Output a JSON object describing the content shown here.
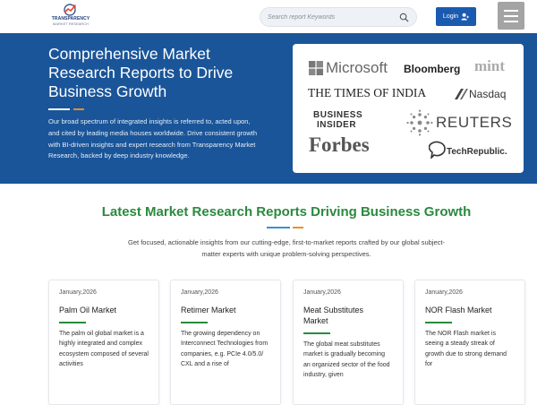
{
  "header": {
    "logo_line1": "TRANSPARENCY",
    "logo_line2": "MARKET RESEARCH",
    "search_placeholder": "Search report Keywords",
    "login_label": "Login"
  },
  "hero": {
    "title": "Comprehensive Market Research Reports to Drive Business Growth",
    "description": "Our broad spectrum of integrated insights is referred to, acted upon, and cited by leading media houses worldwide. Drive consistent growth with BI-driven insights and expert research from Transparency Market Research, backed by deep industry knowledge.",
    "logos": {
      "microsoft": "Microsoft",
      "bloomberg": "Bloomberg",
      "mint": "mint",
      "toi": "THE TIMES OF INDIA",
      "nasdaq": "Nasdaq",
      "bi_line1": "BUSINESS",
      "bi_line2": "INSIDER",
      "reuters": "REUTERS",
      "forbes": "Forbes",
      "techrepublic": "TechRepublic."
    }
  },
  "section": {
    "title": "Latest Market Research Reports Driving Business Growth",
    "description": "Get focused, actionable insights from our cutting-edge, first-to-market reports crafted by our global subject-matter experts with unique problem-solving perspectives."
  },
  "cards": [
    {
      "date": "January,2026",
      "title": "Palm Oil Market",
      "text": "The palm oil global market is a highly integrated and complex ecosystem composed of several activities"
    },
    {
      "date": "January,2026",
      "title": "Retimer Market",
      "text": "The growing dependency on Interconnect Technologies from companies, e.g. PCIe 4.0/5.0/ CXL and a rise of"
    },
    {
      "date": "January,2026",
      "title": "Meat Substitutes Market",
      "text": "The global meat substitutes market is gradually becoming an organized sector of the food industry, given"
    },
    {
      "date": "January,2026",
      "title": "NOR Flash Market",
      "text": "The NOR Flash market is seeing a steady streak of growth due to strong demand for"
    }
  ],
  "colors": {
    "hero_bg": "#1a5599",
    "accent_green": "#2a8a3e",
    "accent_orange": "#f28c28",
    "login_bg": "#1a5bb0"
  },
  "icons": {
    "search": "search-icon",
    "login": "user-icon",
    "menu": "hamburger-menu-icon"
  }
}
